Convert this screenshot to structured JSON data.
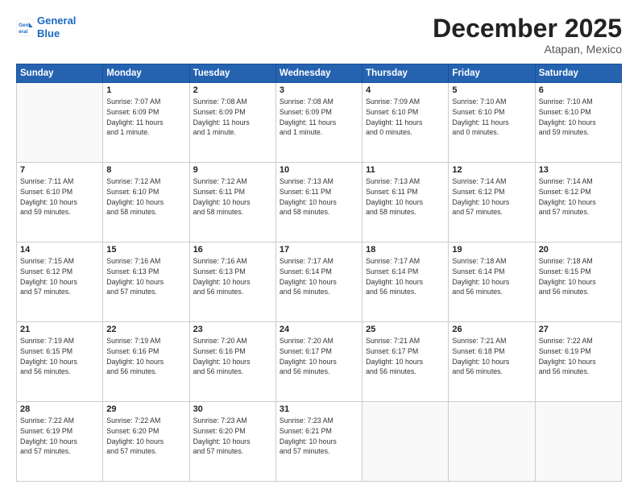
{
  "header": {
    "logo_line1": "General",
    "logo_line2": "Blue",
    "month": "December 2025",
    "location": "Atapan, Mexico"
  },
  "weekdays": [
    "Sunday",
    "Monday",
    "Tuesday",
    "Wednesday",
    "Thursday",
    "Friday",
    "Saturday"
  ],
  "weeks": [
    [
      {
        "day": "",
        "info": ""
      },
      {
        "day": "1",
        "info": "Sunrise: 7:07 AM\nSunset: 6:09 PM\nDaylight: 11 hours\nand 1 minute."
      },
      {
        "day": "2",
        "info": "Sunrise: 7:08 AM\nSunset: 6:09 PM\nDaylight: 11 hours\nand 1 minute."
      },
      {
        "day": "3",
        "info": "Sunrise: 7:08 AM\nSunset: 6:09 PM\nDaylight: 11 hours\nand 1 minute."
      },
      {
        "day": "4",
        "info": "Sunrise: 7:09 AM\nSunset: 6:10 PM\nDaylight: 11 hours\nand 0 minutes."
      },
      {
        "day": "5",
        "info": "Sunrise: 7:10 AM\nSunset: 6:10 PM\nDaylight: 11 hours\nand 0 minutes."
      },
      {
        "day": "6",
        "info": "Sunrise: 7:10 AM\nSunset: 6:10 PM\nDaylight: 10 hours\nand 59 minutes."
      }
    ],
    [
      {
        "day": "7",
        "info": "Sunrise: 7:11 AM\nSunset: 6:10 PM\nDaylight: 10 hours\nand 59 minutes."
      },
      {
        "day": "8",
        "info": "Sunrise: 7:12 AM\nSunset: 6:10 PM\nDaylight: 10 hours\nand 58 minutes."
      },
      {
        "day": "9",
        "info": "Sunrise: 7:12 AM\nSunset: 6:11 PM\nDaylight: 10 hours\nand 58 minutes."
      },
      {
        "day": "10",
        "info": "Sunrise: 7:13 AM\nSunset: 6:11 PM\nDaylight: 10 hours\nand 58 minutes."
      },
      {
        "day": "11",
        "info": "Sunrise: 7:13 AM\nSunset: 6:11 PM\nDaylight: 10 hours\nand 58 minutes."
      },
      {
        "day": "12",
        "info": "Sunrise: 7:14 AM\nSunset: 6:12 PM\nDaylight: 10 hours\nand 57 minutes."
      },
      {
        "day": "13",
        "info": "Sunrise: 7:14 AM\nSunset: 6:12 PM\nDaylight: 10 hours\nand 57 minutes."
      }
    ],
    [
      {
        "day": "14",
        "info": "Sunrise: 7:15 AM\nSunset: 6:12 PM\nDaylight: 10 hours\nand 57 minutes."
      },
      {
        "day": "15",
        "info": "Sunrise: 7:16 AM\nSunset: 6:13 PM\nDaylight: 10 hours\nand 57 minutes."
      },
      {
        "day": "16",
        "info": "Sunrise: 7:16 AM\nSunset: 6:13 PM\nDaylight: 10 hours\nand 56 minutes."
      },
      {
        "day": "17",
        "info": "Sunrise: 7:17 AM\nSunset: 6:14 PM\nDaylight: 10 hours\nand 56 minutes."
      },
      {
        "day": "18",
        "info": "Sunrise: 7:17 AM\nSunset: 6:14 PM\nDaylight: 10 hours\nand 56 minutes."
      },
      {
        "day": "19",
        "info": "Sunrise: 7:18 AM\nSunset: 6:14 PM\nDaylight: 10 hours\nand 56 minutes."
      },
      {
        "day": "20",
        "info": "Sunrise: 7:18 AM\nSunset: 6:15 PM\nDaylight: 10 hours\nand 56 minutes."
      }
    ],
    [
      {
        "day": "21",
        "info": "Sunrise: 7:19 AM\nSunset: 6:15 PM\nDaylight: 10 hours\nand 56 minutes."
      },
      {
        "day": "22",
        "info": "Sunrise: 7:19 AM\nSunset: 6:16 PM\nDaylight: 10 hours\nand 56 minutes."
      },
      {
        "day": "23",
        "info": "Sunrise: 7:20 AM\nSunset: 6:16 PM\nDaylight: 10 hours\nand 56 minutes."
      },
      {
        "day": "24",
        "info": "Sunrise: 7:20 AM\nSunset: 6:17 PM\nDaylight: 10 hours\nand 56 minutes."
      },
      {
        "day": "25",
        "info": "Sunrise: 7:21 AM\nSunset: 6:17 PM\nDaylight: 10 hours\nand 56 minutes."
      },
      {
        "day": "26",
        "info": "Sunrise: 7:21 AM\nSunset: 6:18 PM\nDaylight: 10 hours\nand 56 minutes."
      },
      {
        "day": "27",
        "info": "Sunrise: 7:22 AM\nSunset: 6:19 PM\nDaylight: 10 hours\nand 56 minutes."
      }
    ],
    [
      {
        "day": "28",
        "info": "Sunrise: 7:22 AM\nSunset: 6:19 PM\nDaylight: 10 hours\nand 57 minutes."
      },
      {
        "day": "29",
        "info": "Sunrise: 7:22 AM\nSunset: 6:20 PM\nDaylight: 10 hours\nand 57 minutes."
      },
      {
        "day": "30",
        "info": "Sunrise: 7:23 AM\nSunset: 6:20 PM\nDaylight: 10 hours\nand 57 minutes."
      },
      {
        "day": "31",
        "info": "Sunrise: 7:23 AM\nSunset: 6:21 PM\nDaylight: 10 hours\nand 57 minutes."
      },
      {
        "day": "",
        "info": ""
      },
      {
        "day": "",
        "info": ""
      },
      {
        "day": "",
        "info": ""
      }
    ]
  ]
}
